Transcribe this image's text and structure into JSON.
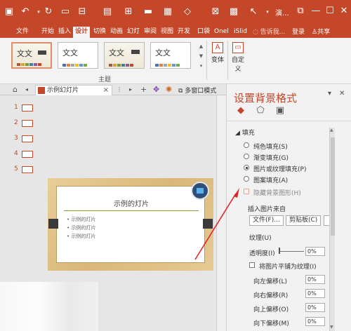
{
  "titlebar": {
    "quick_icons": [
      "save-icon",
      "undo-icon",
      "redo-icon",
      "sync-icon",
      "slide-icon",
      "customize-icon",
      "page-icon",
      "format-icon",
      "style-icon",
      "box-icon",
      "shape-icon",
      "tools-icon",
      "arrow-icon"
    ],
    "doc_title": "演...",
    "controls": [
      "restore-icon",
      "minimize-icon",
      "maximize-icon",
      "close-icon"
    ]
  },
  "menu": {
    "tabs": [
      "文件",
      "开始",
      "插入",
      "设计",
      "切换",
      "动画",
      "幻灯",
      "审阅",
      "视图",
      "开发",
      "口袋",
      "Onel",
      "iSlid"
    ],
    "active": "设计",
    "search": "告诉我...",
    "login": "登录",
    "share": "共享"
  },
  "ribbon": {
    "themes": [
      {
        "title": "文文",
        "style": "wood-selected"
      },
      {
        "title": "文文",
        "style": "plain"
      },
      {
        "title": "文文",
        "style": "wood"
      },
      {
        "title": "文文",
        "style": "plain"
      }
    ],
    "variants_label": "变体",
    "custom_label": "自定义",
    "group_label": "主题"
  },
  "tabstrip": {
    "doc_tab": "示例幻灯片",
    "multiwindow": "多窗口模式"
  },
  "slides": [
    "1",
    "2",
    "3",
    "4",
    "5"
  ],
  "slide": {
    "title": "示例的灯片",
    "bullets": [
      "示例的灯片",
      "示例的灯片",
      "示例的灯片"
    ]
  },
  "panel": {
    "title": "设置背景格式",
    "section": "填充",
    "options": [
      {
        "label": "纯色填充(S)",
        "checked": false
      },
      {
        "label": "渐变填充(G)",
        "checked": false
      },
      {
        "label": "图片或纹理填充(P)",
        "checked": true
      },
      {
        "label": "图案填充(A)",
        "checked": false
      }
    ],
    "hide_bg": "隐藏背景图形(H)",
    "insert_from": "插入图片来自",
    "file_btn": "文件(F)...",
    "clipboard_btn": "剪贴板(C)",
    "texture": "纹理(U)",
    "transparency": "透明度(I)",
    "transparency_value": "0%",
    "tile": "将图片平铺为纹理(I)",
    "offsets": [
      {
        "label": "向左偏移(L)",
        "value": "0%"
      },
      {
        "label": "向右偏移(R)",
        "value": "0%"
      },
      {
        "label": "向上偏移(O)",
        "value": "0%"
      },
      {
        "label": "向下偏移(M)",
        "value": "0%"
      }
    ]
  },
  "colors": {
    "accent": "#c4472a"
  }
}
